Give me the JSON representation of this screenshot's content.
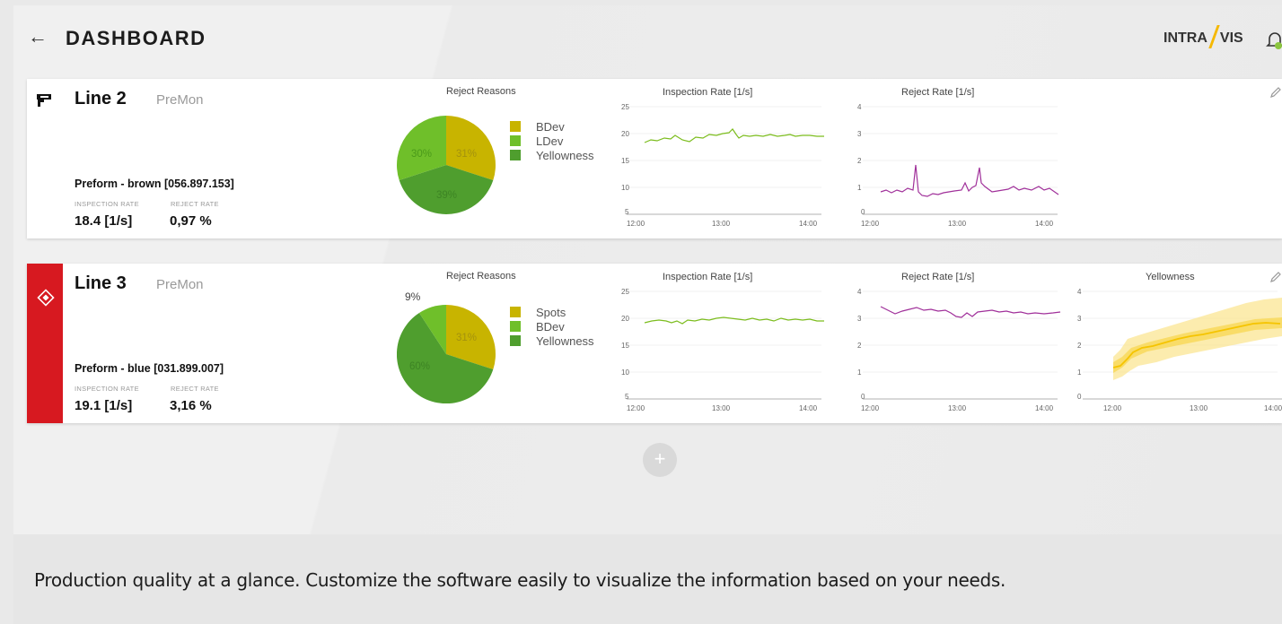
{
  "header": {
    "back_icon": "arrow-left-icon",
    "title": "DASHBOARD",
    "logo": {
      "left": "INTRA",
      "right": "VIS"
    },
    "bell_icon": "bell-icon"
  },
  "colors": {
    "alarm": "#d71920",
    "ok": "#ffffff",
    "series_green": "#7cbd1e",
    "series_purple": "#a0309a",
    "series_yellow": "#f5c400",
    "pie": [
      "#c8b400",
      "#6fbf2a",
      "#4f9e2e"
    ]
  },
  "lines": [
    {
      "name": "Line 2",
      "type": "PreMon",
      "status": "ok",
      "status_icon": "camera-icon",
      "product": "Preform - brown [056.897.153]",
      "inspection_rate_label": "INSPECTION RATE",
      "reject_rate_label": "REJECT RATE",
      "inspection_rate": "18.4 [1/s]",
      "reject_rate": "0,97 %",
      "reject_reasons": {
        "title": "Reject Reasons",
        "slices": [
          {
            "name": "BDev",
            "value": 31,
            "label": "31%"
          },
          {
            "name": "Yellowness",
            "value": 39,
            "label": "39%"
          },
          {
            "name": "LDev",
            "value": 30,
            "label": "30%"
          }
        ],
        "legend": [
          "BDev",
          "LDev",
          "Yellowness"
        ]
      },
      "inspection_chart": {
        "title": "Inspection Rate [1/s]",
        "y_ticks": [
          "25",
          "20",
          "15",
          "10",
          "5"
        ],
        "x_ticks": [
          "12:00",
          "13:00",
          "14:00"
        ]
      },
      "reject_chart": {
        "title": "Reject Rate [1/s]",
        "y_ticks": [
          "4",
          "3",
          "2",
          "1",
          "0"
        ],
        "x_ticks": [
          "12:00",
          "13:00",
          "14:00"
        ]
      }
    },
    {
      "name": "Line 3",
      "type": "PreMon",
      "status": "alarm",
      "status_icon": "warning-diamond-icon",
      "product": "Preform - blue [031.899.007]",
      "inspection_rate_label": "INSPECTION RATE",
      "reject_rate_label": "REJECT RATE",
      "inspection_rate": "19.1 [1/s]",
      "reject_rate": "3,16 %",
      "reject_reasons": {
        "title": "Reject Reasons",
        "slices": [
          {
            "name": "Spots",
            "value": 31,
            "label": "31%"
          },
          {
            "name": "Yellowness",
            "value": 60,
            "label": "60%"
          },
          {
            "name": "BDev",
            "value": 9,
            "label": "9%"
          }
        ],
        "legend": [
          "Spots",
          "BDev",
          "Yellowness"
        ]
      },
      "inspection_chart": {
        "title": "Inspection Rate [1/s]",
        "y_ticks": [
          "25",
          "20",
          "15",
          "10",
          "5"
        ],
        "x_ticks": [
          "12:00",
          "13:00",
          "14:00"
        ]
      },
      "reject_chart": {
        "title": "Reject Rate [1/s]",
        "y_ticks": [
          "4",
          "3",
          "2",
          "1",
          "0"
        ],
        "x_ticks": [
          "12:00",
          "13:00",
          "14:00"
        ]
      },
      "yellowness_chart": {
        "title": "Yellowness",
        "y_ticks": [
          "4",
          "3",
          "2",
          "1",
          "0"
        ],
        "x_ticks": [
          "12:00",
          "13:00",
          "14:00"
        ]
      }
    }
  ],
  "add_button": "+",
  "caption": "Production quality at a glance. Customize the software easily to visualize the information based on your needs."
}
